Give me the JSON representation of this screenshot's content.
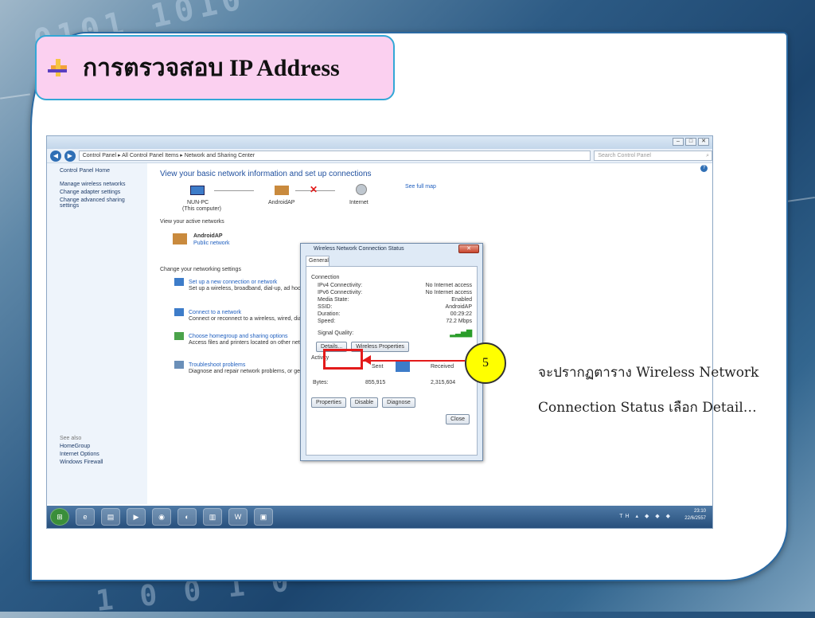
{
  "slide": {
    "title": "การตรวจสอบ IP Address",
    "step_number": "5",
    "description_line1": "จะปรากฏตาราง Wireless Network",
    "description_line2": "Connection Status เลือก Detail…",
    "accent_color": "#fbd0f0",
    "highlight_color": "#e31b1b",
    "step_color": "#ffff00"
  },
  "window": {
    "breadcrumb": "Control Panel ▸ All Control Panel Items ▸ Network and Sharing Center",
    "search_placeholder": "Search Control Panel",
    "sidebar": {
      "items": [
        "Control Panel Home",
        "Manage wireless networks",
        "Change adapter settings",
        "Change advanced sharing settings"
      ],
      "see_also_label": "See also",
      "see_also": [
        "HomeGroup",
        "Internet Options",
        "Windows Firewall"
      ]
    },
    "heading": "View your basic network information and set up connections",
    "see_full_map": "See full map",
    "map": {
      "computer": "NUN-PC",
      "computer_sub": "(This computer)",
      "network": "AndroidAP",
      "internet": "Internet"
    },
    "active_label": "View your active networks",
    "active_name": "AndroidAP",
    "active_type": "Public network",
    "change_label": "Change your networking settings",
    "tasks": [
      {
        "title": "Set up a new connection or network",
        "desc": "Set up a wireless, broadband, dial-up, ad hoc, or VPN"
      },
      {
        "title": "Connect to a network",
        "desc": "Connect or reconnect to a wireless, wired, dial-up"
      },
      {
        "title": "Choose homegroup and sharing options",
        "desc": "Access files and printers located on other network"
      },
      {
        "title": "Troubleshoot problems",
        "desc": "Diagnose and repair network problems, or get"
      }
    ]
  },
  "dialog": {
    "title": "Wireless Network Connection Status",
    "tab": "General",
    "connection_label": "Connection",
    "rows": [
      {
        "k": "IPv4 Connectivity:",
        "v": "No Internet access"
      },
      {
        "k": "IPv6 Connectivity:",
        "v": "No Internet access"
      },
      {
        "k": "Media State:",
        "v": "Enabled"
      },
      {
        "k": "SSID:",
        "v": "AndroidAP"
      },
      {
        "k": "Duration:",
        "v": "00:29:22"
      },
      {
        "k": "Speed:",
        "v": "72.2 Mbps"
      }
    ],
    "signal_label": "Signal Quality:",
    "details_btn": "Details...",
    "wireless_props_btn": "Wireless Properties",
    "activity_label": "Activity",
    "sent": "Sent",
    "received": "Received",
    "bytes_label": "Bytes:",
    "bytes_sent": "855,915",
    "bytes_received": "2,315,604",
    "properties_btn": "Properties",
    "disable_btn": "Disable",
    "diagnose_btn": "Diagnose",
    "close_btn": "Close"
  },
  "taskbar": {
    "lang": "TH",
    "time": "23:10",
    "date": "22/6/2557"
  }
}
